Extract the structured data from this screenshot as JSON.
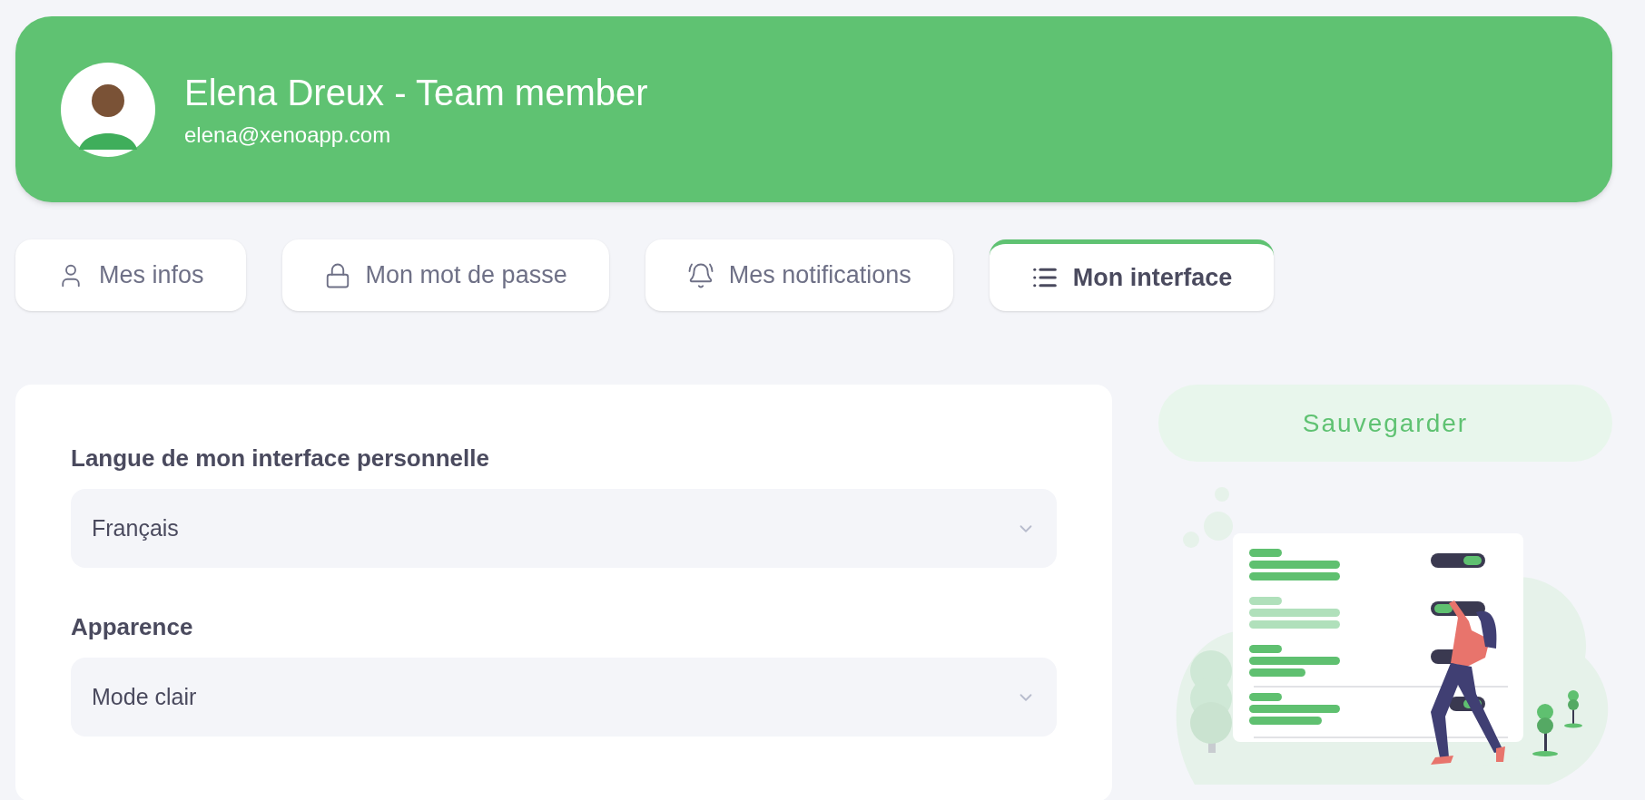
{
  "profile": {
    "name": "Elena Dreux - Team member",
    "email": "elena@xenoapp.com"
  },
  "tabs": [
    {
      "label": "Mes infos",
      "kind": "user",
      "selected": false
    },
    {
      "label": "Mon mot de passe",
      "kind": "lock",
      "selected": false
    },
    {
      "label": "Mes notifications",
      "kind": "bell",
      "selected": false
    },
    {
      "label": "Mon interface",
      "kind": "list",
      "selected": true
    }
  ],
  "settings": [
    {
      "label": "Langue de mon interface personnelle",
      "value": "Français"
    },
    {
      "label": "Apparence",
      "value": "Mode clair"
    }
  ],
  "save_button": "Sauvegarder"
}
